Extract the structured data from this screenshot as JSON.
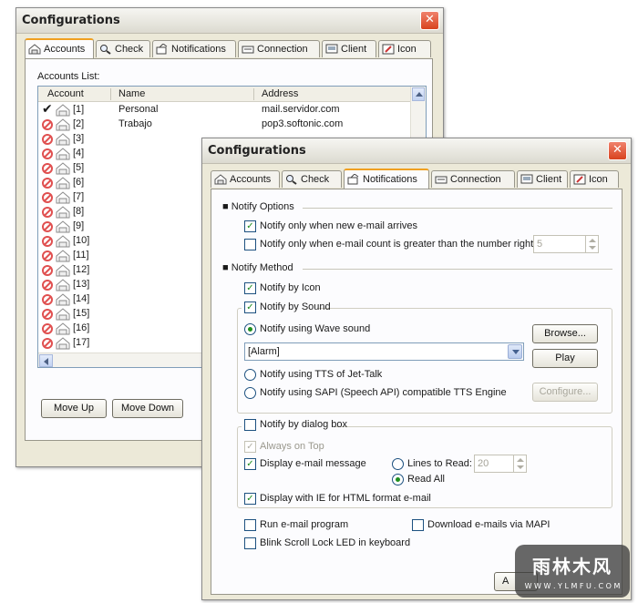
{
  "back_window": {
    "title": "Configurations",
    "tabs": [
      {
        "label": "Accounts",
        "icon": "accounts-icon",
        "active": true
      },
      {
        "label": "Check",
        "icon": "check-magnifier-icon"
      },
      {
        "label": "Notifications",
        "icon": "notifications-icon"
      },
      {
        "label": "Connection",
        "icon": "connection-icon"
      },
      {
        "label": "Client",
        "icon": "client-icon"
      },
      {
        "label": "Icon",
        "icon": "icon-tab-icon"
      }
    ],
    "accounts_list_label": "Accounts List:",
    "columns": [
      "Account",
      "Name",
      "Address"
    ],
    "rows": [
      {
        "num": "[1]",
        "enabled": true,
        "name": "Personal",
        "address": "mail.servidor.com"
      },
      {
        "num": "[2]",
        "enabled": false,
        "name": "Trabajo",
        "address": "pop3.softonic.com"
      },
      {
        "num": "[3]",
        "enabled": false,
        "name": "",
        "address": ""
      },
      {
        "num": "[4]",
        "enabled": false,
        "name": "",
        "address": ""
      },
      {
        "num": "[5]",
        "enabled": false,
        "name": "",
        "address": ""
      },
      {
        "num": "[6]",
        "enabled": false,
        "name": "",
        "address": ""
      },
      {
        "num": "[7]",
        "enabled": false,
        "name": "",
        "address": ""
      },
      {
        "num": "[8]",
        "enabled": false,
        "name": "",
        "address": ""
      },
      {
        "num": "[9]",
        "enabled": false,
        "name": "",
        "address": ""
      },
      {
        "num": "[10]",
        "enabled": false,
        "name": "",
        "address": ""
      },
      {
        "num": "[11]",
        "enabled": false,
        "name": "",
        "address": ""
      },
      {
        "num": "[12]",
        "enabled": false,
        "name": "",
        "address": ""
      },
      {
        "num": "[13]",
        "enabled": false,
        "name": "",
        "address": ""
      },
      {
        "num": "[14]",
        "enabled": false,
        "name": "",
        "address": ""
      },
      {
        "num": "[15]",
        "enabled": false,
        "name": "",
        "address": ""
      },
      {
        "num": "[16]",
        "enabled": false,
        "name": "",
        "address": ""
      },
      {
        "num": "[17]",
        "enabled": false,
        "name": "",
        "address": ""
      }
    ],
    "move_up": "Move Up",
    "move_down": "Move Down"
  },
  "front_window": {
    "title": "Configurations",
    "tabs": [
      {
        "label": "Accounts",
        "icon": "accounts-icon"
      },
      {
        "label": "Check",
        "icon": "check-magnifier-icon"
      },
      {
        "label": "Notifications",
        "icon": "notifications-icon",
        "active": true
      },
      {
        "label": "Connection",
        "icon": "connection-icon"
      },
      {
        "label": "Client",
        "icon": "client-icon"
      },
      {
        "label": "Icon",
        "icon": "icon-tab-icon"
      }
    ],
    "notify_options_header": "Notify Options",
    "opt_new_mail": {
      "label": "Notify only when new e-mail arrives",
      "checked": true
    },
    "opt_count": {
      "label": "Notify only when e-mail count is greater than the number right",
      "checked": false
    },
    "count_value": "5",
    "notify_method_header": "Notify Method",
    "by_icon": {
      "label": "Notify by Icon",
      "checked": true
    },
    "by_sound": {
      "label": "Notify by Sound",
      "checked": true
    },
    "wave_sound": {
      "label": "Notify using Wave sound",
      "selected": true
    },
    "sound_select_value": "[Alarm]",
    "browse": "Browse...",
    "play": "Play",
    "tts_jet": {
      "label": "Notify using TTS of Jet-Talk",
      "selected": false
    },
    "tts_sapi": {
      "label": "Notify using SAPI (Speech API) compatible TTS Engine",
      "selected": false
    },
    "configure": "Configure...",
    "dialog_box": {
      "label": "Notify by dialog box",
      "checked": false
    },
    "always_on_top": {
      "label": "Always on Top",
      "checked": true
    },
    "display_message": {
      "label": "Display e-mail message",
      "checked": true
    },
    "lines_to_read": {
      "label": "Lines to Read:",
      "selected": false
    },
    "lines_value": "20",
    "read_all": {
      "label": "Read All",
      "selected": true
    },
    "display_ie": {
      "label": "Display with IE for HTML format e-mail",
      "checked": true
    },
    "run_email": {
      "label": "Run e-mail program",
      "checked": false
    },
    "download_mapi": {
      "label": "Download e-mails via MAPI",
      "checked": false
    },
    "blink_scroll": {
      "label": "Blink Scroll Lock LED in keyboard",
      "checked": false
    },
    "bottom_button_partial": "A"
  },
  "watermark": {
    "line1": "雨林木风",
    "line2": "W W W . Y L M F U . C O M"
  },
  "colors": {
    "window_bg": "#ece9d8",
    "panel_bg": "#fcfcfe",
    "close_red": "#d8431f",
    "active_tab_accent": "#f0a020",
    "check_green": "#1b8a1b"
  }
}
